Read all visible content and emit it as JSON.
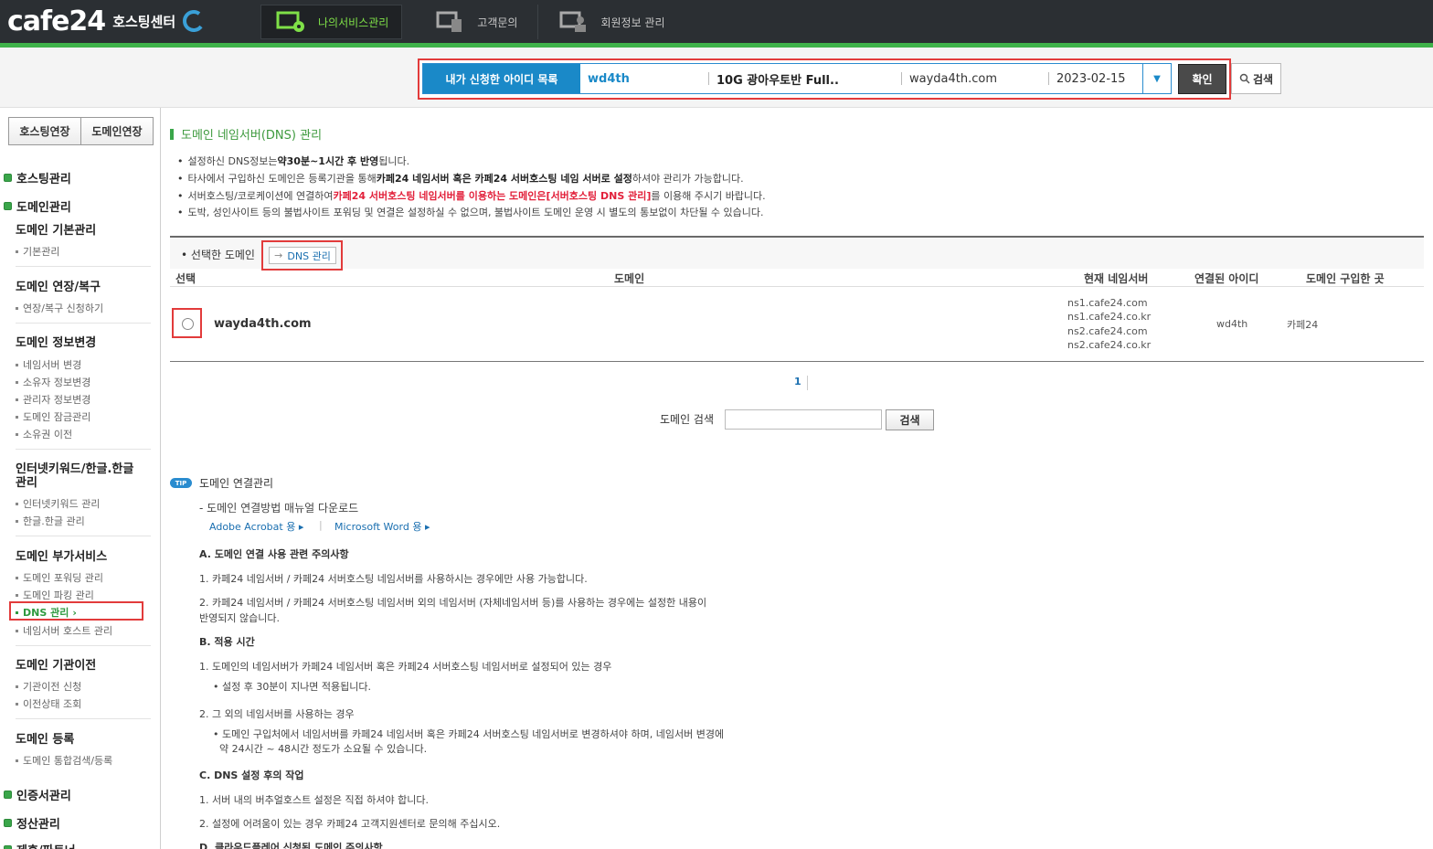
{
  "header": {
    "logo": "cafe24",
    "logo_sub": "호스팅센터",
    "nav": [
      {
        "label": "나의서비스관리",
        "icon": "server-settings-icon"
      },
      {
        "label": "고객문의",
        "icon": "support-icon"
      },
      {
        "label": "회원정보 관리",
        "icon": "member-icon"
      }
    ]
  },
  "idbar": {
    "label": "내가 신청한 아이디 목록",
    "user_id": "wd4th",
    "product": "10G 광아우토반 Full..",
    "domain": "wayda4th.com",
    "date": "2023-02-15",
    "confirm": "확인",
    "search": "검색"
  },
  "sidebar": {
    "tab_hosting": "호스팅연장",
    "tab_domain": "도메인연장",
    "top_hosting": "호스팅관리",
    "top_domain": "도메인관리",
    "groups": [
      {
        "title": "도메인 기본관리",
        "items": [
          "기본관리"
        ]
      },
      {
        "title": "도메인 연장/복구",
        "items": [
          "연장/복구 신청하기"
        ]
      },
      {
        "title": "도메인 정보변경",
        "items": [
          "네임서버 변경",
          "소유자 정보변경",
          "관리자 정보변경",
          "도메인 잠금관리",
          "소유권 이전"
        ]
      },
      {
        "title": "인터넷키워드/한글.한글 관리",
        "items": [
          "인터넷키워드 관리",
          "한글.한글 관리"
        ]
      },
      {
        "title": "도메인 부가서비스",
        "items": [
          "도메인 포워딩 관리",
          "도메인 파킹 관리",
          "DNS 관리",
          "네임서버 호스트 관리"
        ]
      },
      {
        "title": "도메인 기관이전",
        "items": [
          "기관이전 신청",
          "이전상태 조회"
        ]
      },
      {
        "title": "도메인 등록",
        "items": [
          "도메인 통합검색/등록"
        ]
      }
    ],
    "top_cert": "인증서관리",
    "top_billing": "정산관리",
    "top_partner": "제휴/파트너"
  },
  "main": {
    "title": "도메인 네임서버(DNS) 관리",
    "notices": [
      {
        "pre": "설정하신 DNS정보는 ",
        "bold": "약30분~1시간 후 반영",
        "post": "됩니다."
      },
      {
        "pre": "타사에서 구입하신 도메인은 등록기관을 통해 ",
        "bold": "카페24 네임서버 혹은 카페24 서버호스팅 네임 서버로 설정",
        "post": "하셔야 관리가 가능합니다."
      },
      {
        "pre": "서버호스팅/코로케이션에 연결하여 ",
        "red": "카페24 서버호스팅 네임서버를 이용하는 도메인은[서버호스팅 DNS 관리]",
        "post": "를 이용해 주시기 바랍니다."
      },
      {
        "pre": "도박, 성인사이트 등의 불법사이트 포워딩 및 연결은 설정하실 수 없으며, 불법사이트 도메인 운영 시 별도의 통보없이 차단될 수 있습니다."
      }
    ],
    "selected_label": "선택한 도메인",
    "dns_button": "DNS 관리",
    "columns": [
      "선택",
      "도메인",
      "현재 네임서버",
      "연결된 아이디",
      "도메인 구입한 곳"
    ],
    "row": {
      "domain": "wayda4th.com",
      "nameservers": [
        "ns1.cafe24.com",
        "ns1.cafe24.co.kr",
        "ns2.cafe24.com",
        "ns2.cafe24.co.kr"
      ],
      "user_id": "wd4th",
      "registrar": "카페24"
    },
    "page": "1",
    "search_label": "도메인 검색",
    "search_btn": "검색"
  },
  "tip": {
    "badge": "TIP",
    "title": "도메인 연결관리",
    "manual": "- 도메인 연결방법 매뉴얼 다운로드",
    "link_acrobat": "Adobe Acrobat 용",
    "link_word": "Microsoft Word 용",
    "sec_a": "A. 도메인 연결 사용 관련 주의사항",
    "a1": "1. 카페24 네임서버 / 카페24 서버호스팅 네임서버를 사용하시는 경우에만 사용 가능합니다.",
    "a2": "2. 카페24 네임서버 / 카페24 서버호스팅 네임서버 외의 네임서버 (자체네임서버 등)를 사용하는 경우에는 설정한 내용이",
    "a2b": "반영되지 않습니다.",
    "sec_b": "B. 적용 시간",
    "b1": "1. 도메인의 네임서버가 카페24 네임서버 혹은 카페24 서버호스팅 네임서버로 설정되어 있는 경우",
    "b1a": "• 설정 후 30분이 지나면 적용됩니다.",
    "b2": "2. 그 외의 네임서버를 사용하는 경우",
    "b2a": "• 도메인 구입처에서 네임서버를 카페24 네임서버 혹은 카페24 서버호스팅 네임서버로 변경하셔야 하며, 네임서버 변경에",
    "b2b": "약 24시간 ~ 48시간 정도가 소요될 수 있습니다.",
    "sec_c": "C. DNS 설정 후의 작업",
    "c1": "1. 서버 내의 버추얼호스트 설정은 직접 하셔야 합니다.",
    "c2": "2. 설정에 어려움이 있는 경우 카페24 고객지원센터로 문의해 주십시오.",
    "sec_d": "D. 클라우드플레어 신청된 도메인 주의사항"
  }
}
